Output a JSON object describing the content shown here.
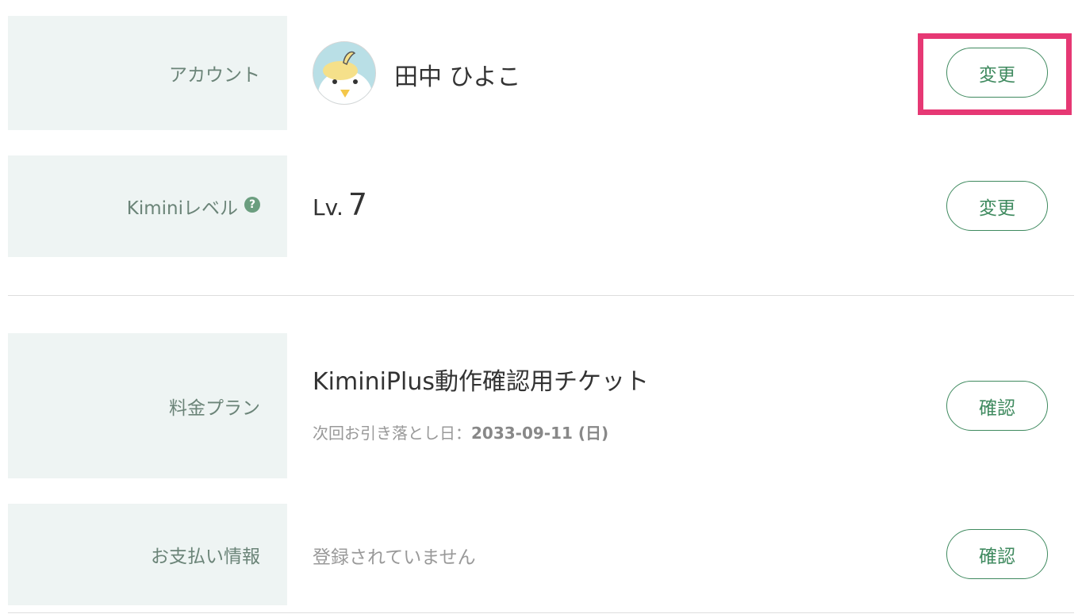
{
  "account": {
    "label": "アカウント",
    "name": "田中 ひよこ",
    "button": "変更"
  },
  "level": {
    "label": "Kiminiレベル",
    "help_icon": "?",
    "prefix": "Lv.",
    "value": "7",
    "button": "変更"
  },
  "plan": {
    "label": "料金プラン",
    "name": "KiminiPlus動作確認用チケット",
    "next_billing_label": "次回お引き落とし日：",
    "next_billing_date": "2033-09-11 (日)",
    "button": "確認"
  },
  "payment": {
    "label": "お支払い情報",
    "status": "登録されていません",
    "button": "確認"
  },
  "colors": {
    "label_bg": "#eef4f3",
    "accent_green": "#3f8a5f",
    "highlight": "#e63874"
  },
  "icons": {
    "avatar": "chick-avatar-icon",
    "help": "question-circle-icon"
  }
}
